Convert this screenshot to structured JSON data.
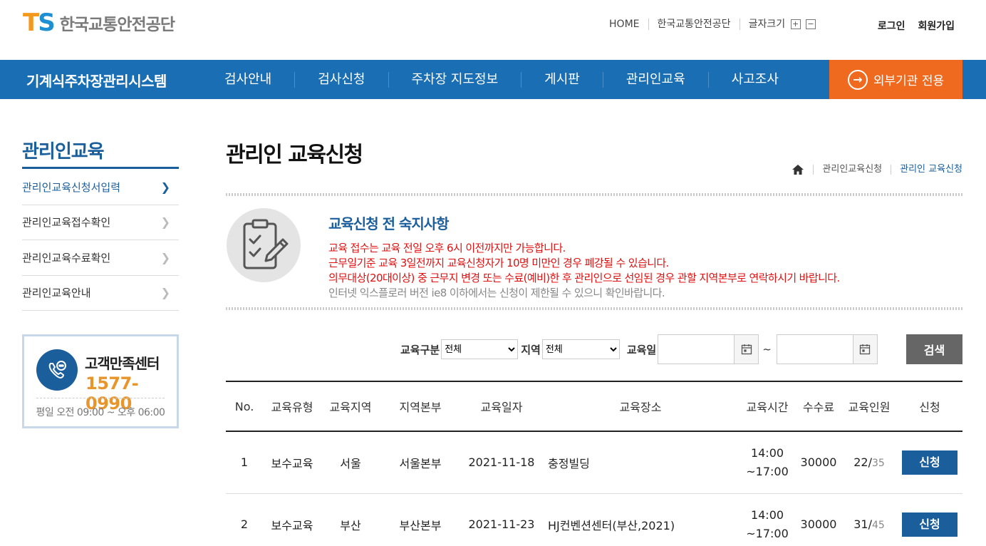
{
  "header": {
    "logo_mark_t": "T",
    "logo_mark_s": "S",
    "logo_text": "한국교통안전공단",
    "utils": [
      "HOME",
      "한국교통안전공단"
    ],
    "font_size_label": "글자크기",
    "font_plus": "+",
    "font_minus": "−",
    "login": "로그인",
    "signup": "회원가입"
  },
  "nav": {
    "brand": "기계식주차장관리시스템",
    "items": [
      "검사안내",
      "검사신청",
      "주차장 지도정보",
      "게시판",
      "관리인교육",
      "사고조사"
    ],
    "external": "외부기관 전용"
  },
  "sidebar": {
    "title": "관리인교육",
    "items": [
      "관리인교육신청서입력",
      "관리인교육접수확인",
      "관리인교육수료확인",
      "관리인교육안내"
    ],
    "cs_title": "고객만족센터",
    "cs_phone": "1577-0990",
    "cs_hours": "평일 오전 09:00 ~ 오후 06:00"
  },
  "main": {
    "title": "관리인 교육신청",
    "breadcrumb": [
      "관리인교육신청",
      "관리인 교육신청"
    ],
    "notice_title": "교육신청 전 숙지사항",
    "notice_red": [
      "교육 접수는 교육 전일 오후 6시 이전까지만 가능합니다.",
      "근무일기준 교육 3일전까지 교육신청자가 10명 미만인 경우 폐강될 수 있습니다.",
      "의무대상(20대이상) 중 근무지 변경 또는 수료(예비)한 후 관리인으로 선임된 경우 관할 지역본부로 연락하시기 바랍니다."
    ],
    "notice_gray": "인터넷 익스플로러 버전 ie8 이하에서는 신청이 제한될 수 있으니 확인바랍니다."
  },
  "search": {
    "type_label": "교육구분",
    "type_value": "전체",
    "region_label": "지역",
    "region_value": "전체",
    "date_label": "교육일",
    "tilde": "~",
    "button": "검색"
  },
  "table": {
    "headers": [
      "No.",
      "교육유형",
      "교육지역",
      "지역본부",
      "교육일자",
      "교육장소",
      "교육시간",
      "수수료",
      "교육인원",
      "신청"
    ],
    "rows": [
      {
        "no": "1",
        "type": "보수교육",
        "region": "서울",
        "hq": "서울본부",
        "date": "2021-11-18",
        "place": "충정빌딩",
        "time_start": "14:00",
        "time_end": "~17:00",
        "fee": "30000",
        "enrolled": "22/",
        "capacity": "35",
        "apply": "신청"
      },
      {
        "no": "2",
        "type": "보수교육",
        "region": "부산",
        "hq": "부산본부",
        "date": "2021-11-23",
        "place": "HJ컨벤션센터(부산,2021)",
        "time_start": "14:00",
        "time_end": "~17:00",
        "fee": "30000",
        "enrolled": "31/",
        "capacity": "45",
        "apply": "신청"
      }
    ]
  },
  "colors": {
    "nav_bg": "#1a6eb3",
    "accent_blue": "#1a5e9c",
    "external_btn": "#ef6a1f",
    "phone": "#e8952c",
    "notice_red": "#e01010"
  }
}
